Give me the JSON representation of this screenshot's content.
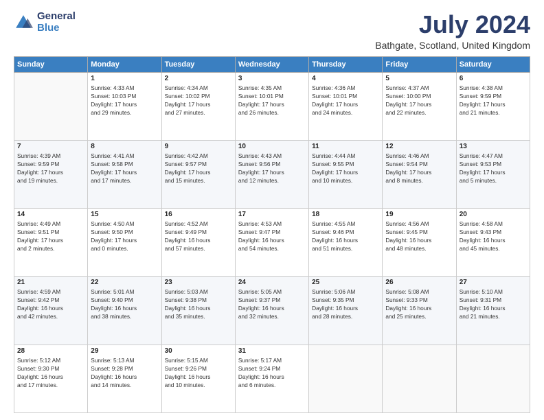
{
  "logo": {
    "general": "General",
    "blue": "Blue"
  },
  "header": {
    "month_year": "July 2024",
    "location": "Bathgate, Scotland, United Kingdom"
  },
  "days_of_week": [
    "Sunday",
    "Monday",
    "Tuesday",
    "Wednesday",
    "Thursday",
    "Friday",
    "Saturday"
  ],
  "weeks": [
    [
      {
        "day": "",
        "info": ""
      },
      {
        "day": "1",
        "info": "Sunrise: 4:33 AM\nSunset: 10:03 PM\nDaylight: 17 hours\nand 29 minutes."
      },
      {
        "day": "2",
        "info": "Sunrise: 4:34 AM\nSunset: 10:02 PM\nDaylight: 17 hours\nand 27 minutes."
      },
      {
        "day": "3",
        "info": "Sunrise: 4:35 AM\nSunset: 10:01 PM\nDaylight: 17 hours\nand 26 minutes."
      },
      {
        "day": "4",
        "info": "Sunrise: 4:36 AM\nSunset: 10:01 PM\nDaylight: 17 hours\nand 24 minutes."
      },
      {
        "day": "5",
        "info": "Sunrise: 4:37 AM\nSunset: 10:00 PM\nDaylight: 17 hours\nand 22 minutes."
      },
      {
        "day": "6",
        "info": "Sunrise: 4:38 AM\nSunset: 9:59 PM\nDaylight: 17 hours\nand 21 minutes."
      }
    ],
    [
      {
        "day": "7",
        "info": "Sunrise: 4:39 AM\nSunset: 9:59 PM\nDaylight: 17 hours\nand 19 minutes."
      },
      {
        "day": "8",
        "info": "Sunrise: 4:41 AM\nSunset: 9:58 PM\nDaylight: 17 hours\nand 17 minutes."
      },
      {
        "day": "9",
        "info": "Sunrise: 4:42 AM\nSunset: 9:57 PM\nDaylight: 17 hours\nand 15 minutes."
      },
      {
        "day": "10",
        "info": "Sunrise: 4:43 AM\nSunset: 9:56 PM\nDaylight: 17 hours\nand 12 minutes."
      },
      {
        "day": "11",
        "info": "Sunrise: 4:44 AM\nSunset: 9:55 PM\nDaylight: 17 hours\nand 10 minutes."
      },
      {
        "day": "12",
        "info": "Sunrise: 4:46 AM\nSunset: 9:54 PM\nDaylight: 17 hours\nand 8 minutes."
      },
      {
        "day": "13",
        "info": "Sunrise: 4:47 AM\nSunset: 9:53 PM\nDaylight: 17 hours\nand 5 minutes."
      }
    ],
    [
      {
        "day": "14",
        "info": "Sunrise: 4:49 AM\nSunset: 9:51 PM\nDaylight: 17 hours\nand 2 minutes."
      },
      {
        "day": "15",
        "info": "Sunrise: 4:50 AM\nSunset: 9:50 PM\nDaylight: 17 hours\nand 0 minutes."
      },
      {
        "day": "16",
        "info": "Sunrise: 4:52 AM\nSunset: 9:49 PM\nDaylight: 16 hours\nand 57 minutes."
      },
      {
        "day": "17",
        "info": "Sunrise: 4:53 AM\nSunset: 9:47 PM\nDaylight: 16 hours\nand 54 minutes."
      },
      {
        "day": "18",
        "info": "Sunrise: 4:55 AM\nSunset: 9:46 PM\nDaylight: 16 hours\nand 51 minutes."
      },
      {
        "day": "19",
        "info": "Sunrise: 4:56 AM\nSunset: 9:45 PM\nDaylight: 16 hours\nand 48 minutes."
      },
      {
        "day": "20",
        "info": "Sunrise: 4:58 AM\nSunset: 9:43 PM\nDaylight: 16 hours\nand 45 minutes."
      }
    ],
    [
      {
        "day": "21",
        "info": "Sunrise: 4:59 AM\nSunset: 9:42 PM\nDaylight: 16 hours\nand 42 minutes."
      },
      {
        "day": "22",
        "info": "Sunrise: 5:01 AM\nSunset: 9:40 PM\nDaylight: 16 hours\nand 38 minutes."
      },
      {
        "day": "23",
        "info": "Sunrise: 5:03 AM\nSunset: 9:38 PM\nDaylight: 16 hours\nand 35 minutes."
      },
      {
        "day": "24",
        "info": "Sunrise: 5:05 AM\nSunset: 9:37 PM\nDaylight: 16 hours\nand 32 minutes."
      },
      {
        "day": "25",
        "info": "Sunrise: 5:06 AM\nSunset: 9:35 PM\nDaylight: 16 hours\nand 28 minutes."
      },
      {
        "day": "26",
        "info": "Sunrise: 5:08 AM\nSunset: 9:33 PM\nDaylight: 16 hours\nand 25 minutes."
      },
      {
        "day": "27",
        "info": "Sunrise: 5:10 AM\nSunset: 9:31 PM\nDaylight: 16 hours\nand 21 minutes."
      }
    ],
    [
      {
        "day": "28",
        "info": "Sunrise: 5:12 AM\nSunset: 9:30 PM\nDaylight: 16 hours\nand 17 minutes."
      },
      {
        "day": "29",
        "info": "Sunrise: 5:13 AM\nSunset: 9:28 PM\nDaylight: 16 hours\nand 14 minutes."
      },
      {
        "day": "30",
        "info": "Sunrise: 5:15 AM\nSunset: 9:26 PM\nDaylight: 16 hours\nand 10 minutes."
      },
      {
        "day": "31",
        "info": "Sunrise: 5:17 AM\nSunset: 9:24 PM\nDaylight: 16 hours\nand 6 minutes."
      },
      {
        "day": "",
        "info": ""
      },
      {
        "day": "",
        "info": ""
      },
      {
        "day": "",
        "info": ""
      }
    ]
  ]
}
